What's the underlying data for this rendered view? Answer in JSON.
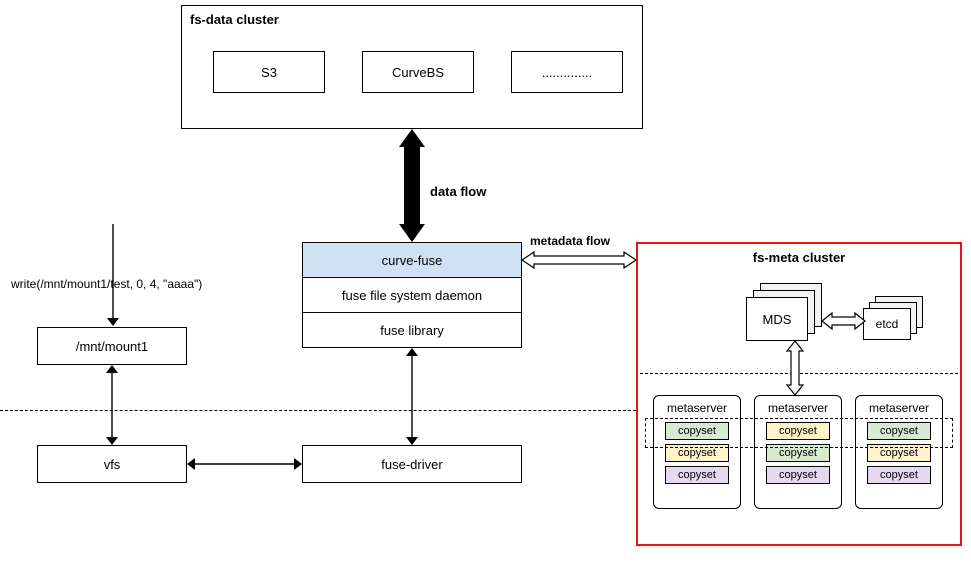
{
  "fsdata": {
    "title": "fs-data cluster",
    "items": [
      "S3",
      "CurveBS",
      ".............."
    ]
  },
  "dataflow_label": "data flow",
  "metadataflow_label": "metadata flow",
  "write_call": "write(/mnt/mount1/test, 0, 4, \"aaaa\")",
  "mountpoint": "/mnt/mount1",
  "vfs": "vfs",
  "fusedriver": "fuse-driver",
  "middle": {
    "curvefuse": "curve-fuse",
    "daemon": "fuse file system daemon",
    "library": "fuse library"
  },
  "fsmeta": {
    "title": "fs-meta  cluster",
    "mds": "MDS",
    "etcd": "etcd",
    "metaserver_label": "metaserver",
    "copyset_label": "copyset"
  }
}
